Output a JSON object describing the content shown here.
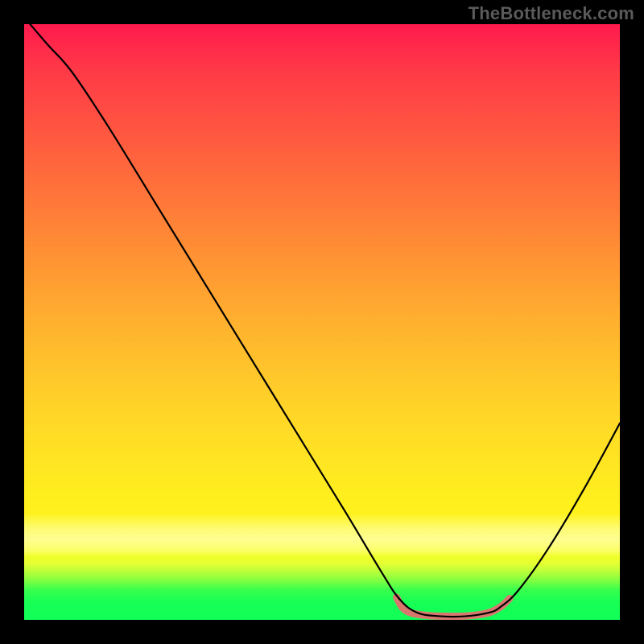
{
  "watermark": "TheBottleneck.com",
  "chart_data": {
    "type": "line",
    "title": "",
    "xlabel": "",
    "ylabel": "",
    "xlim": [
      0,
      100
    ],
    "ylim": [
      0,
      100
    ],
    "series": [
      {
        "name": "curve",
        "stroke": "#000000",
        "stroke_width": 2.2,
        "x": [
          1,
          4,
          8,
          14,
          22,
          30,
          38,
          46,
          54,
          60,
          63,
          66,
          70,
          74,
          78,
          80,
          83,
          88,
          94,
          100
        ],
        "y": [
          100,
          96.5,
          92,
          83,
          70,
          57,
          44,
          31,
          18,
          8,
          3.5,
          1.2,
          0.6,
          0.6,
          1.2,
          2.2,
          5,
          12,
          22,
          33
        ]
      },
      {
        "name": "highlight-trough",
        "stroke": "#d9776f",
        "stroke_width": 9,
        "linecap": "round",
        "x": [
          62.5,
          64,
          67,
          71,
          75,
          78,
          80,
          81.5
        ],
        "y": [
          3.8,
          1.6,
          0.8,
          0.6,
          0.7,
          1.2,
          2.2,
          3.6
        ]
      }
    ],
    "background": {
      "type": "vertical-gradient",
      "stops": [
        {
          "pos": 0.0,
          "color": "#ff1a4d"
        },
        {
          "pos": 0.25,
          "color": "#ff6a3c"
        },
        {
          "pos": 0.52,
          "color": "#ffb62e"
        },
        {
          "pos": 0.82,
          "color": "#fff21c"
        },
        {
          "pos": 0.92,
          "color": "#b6ff3a"
        },
        {
          "pos": 1.0,
          "color": "#10ff58"
        }
      ]
    }
  }
}
